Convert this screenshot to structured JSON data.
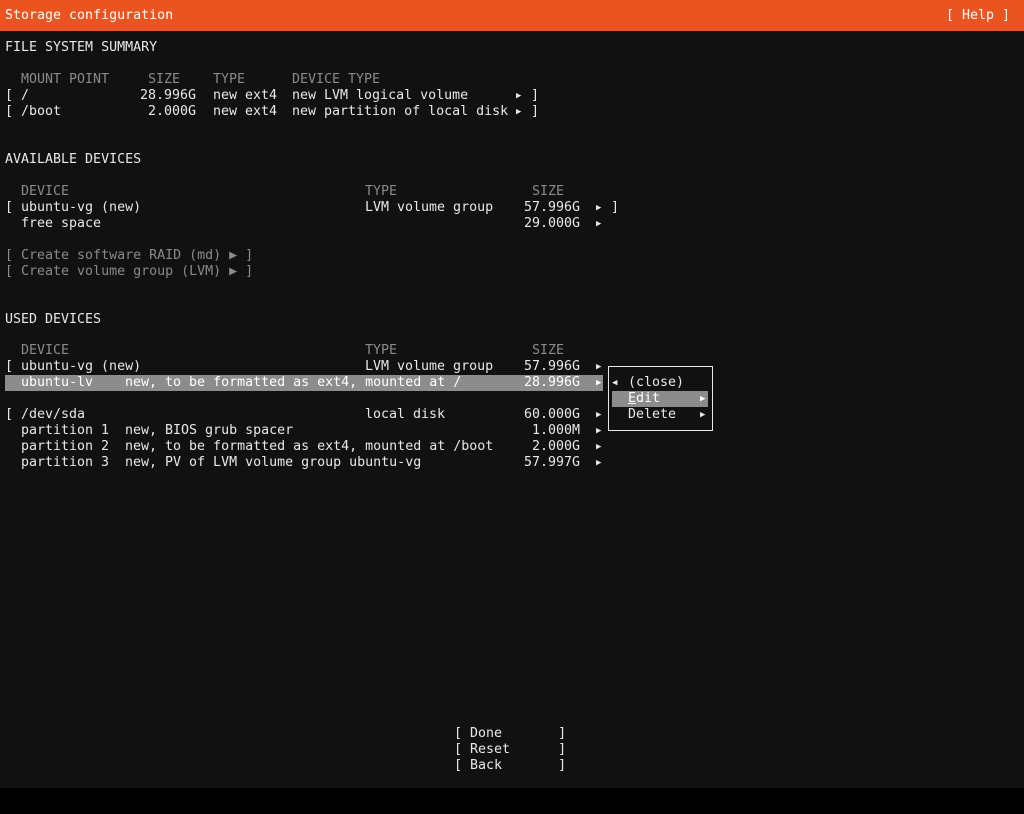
{
  "header": {
    "title": "Storage configuration",
    "help_label": "[ Help ]"
  },
  "fs_summary": {
    "heading": "FILE SYSTEM SUMMARY",
    "columns": {
      "mount": "MOUNT POINT",
      "size": "SIZE",
      "type": "TYPE",
      "device_type": "DEVICE TYPE"
    },
    "rows": [
      {
        "bracket_open": "[",
        "mount": "/",
        "size": "28.996G",
        "type": "new ext4",
        "device_type": "new LVM logical volume",
        "arrow": "▶",
        "bracket_close": "]"
      },
      {
        "bracket_open": "[",
        "mount": "/boot",
        "size": "2.000G",
        "type": "new ext4",
        "device_type": "new partition of local disk",
        "arrow": "▶",
        "bracket_close": "]"
      }
    ]
  },
  "available": {
    "heading": "AVAILABLE DEVICES",
    "columns": {
      "device": "DEVICE",
      "type": "TYPE",
      "size": "SIZE"
    },
    "rows": [
      {
        "bracket_open": "[",
        "device": "ubuntu-vg (new)",
        "type": "LVM volume group",
        "size": "57.996G",
        "arrow": "▶",
        "bracket_close": "]"
      },
      {
        "device": "free space",
        "size": "29.000G",
        "arrow": "▶"
      }
    ],
    "actions": [
      {
        "label": "[ Create software RAID (md) ▶ ]"
      },
      {
        "label": "[ Create volume group (LVM) ▶ ]"
      }
    ]
  },
  "used": {
    "heading": "USED DEVICES",
    "columns": {
      "device": "DEVICE",
      "type": "TYPE",
      "size": "SIZE"
    },
    "vg_row": {
      "bracket_open": "[",
      "device": "ubuntu-vg (new)",
      "type": "LVM volume group",
      "size": "57.996G",
      "arrow": "▶"
    },
    "lv_row": {
      "device": "ubuntu-lv",
      "desc": "new, to be formatted as ext4, mounted at /",
      "size": "28.996G",
      "arrow": "▶"
    },
    "disk_row": {
      "bracket_open": "[",
      "device": "/dev/sda",
      "type": "local disk",
      "size": "60.000G",
      "arrow": "▶"
    },
    "partitions": [
      {
        "name": "partition 1",
        "desc": "new, BIOS grub spacer",
        "size": "1.000M",
        "arrow": "▶"
      },
      {
        "name": "partition 2",
        "desc": "new, to be formatted as ext4, mounted at /boot",
        "size": "2.000G",
        "arrow": "▶"
      },
      {
        "name": "partition 3",
        "desc": "new, PV of LVM volume group ubuntu-vg",
        "size": "57.997G",
        "arrow": "▶"
      }
    ]
  },
  "popup": {
    "close_arrow": "◀",
    "close_label": "(close)",
    "edit_first": "E",
    "edit_rest": "dit",
    "delete_label": "Delete",
    "arrow": "▶"
  },
  "footer": {
    "buttons": [
      {
        "label": "[ Done       ]"
      },
      {
        "label": "[ Reset      ]"
      },
      {
        "label": "[ Back       ]"
      }
    ]
  },
  "colors": {
    "accent": "#e95420",
    "background": "#111111",
    "highlight": "#8c8c8c",
    "dim_text": "#8a8a8a"
  }
}
